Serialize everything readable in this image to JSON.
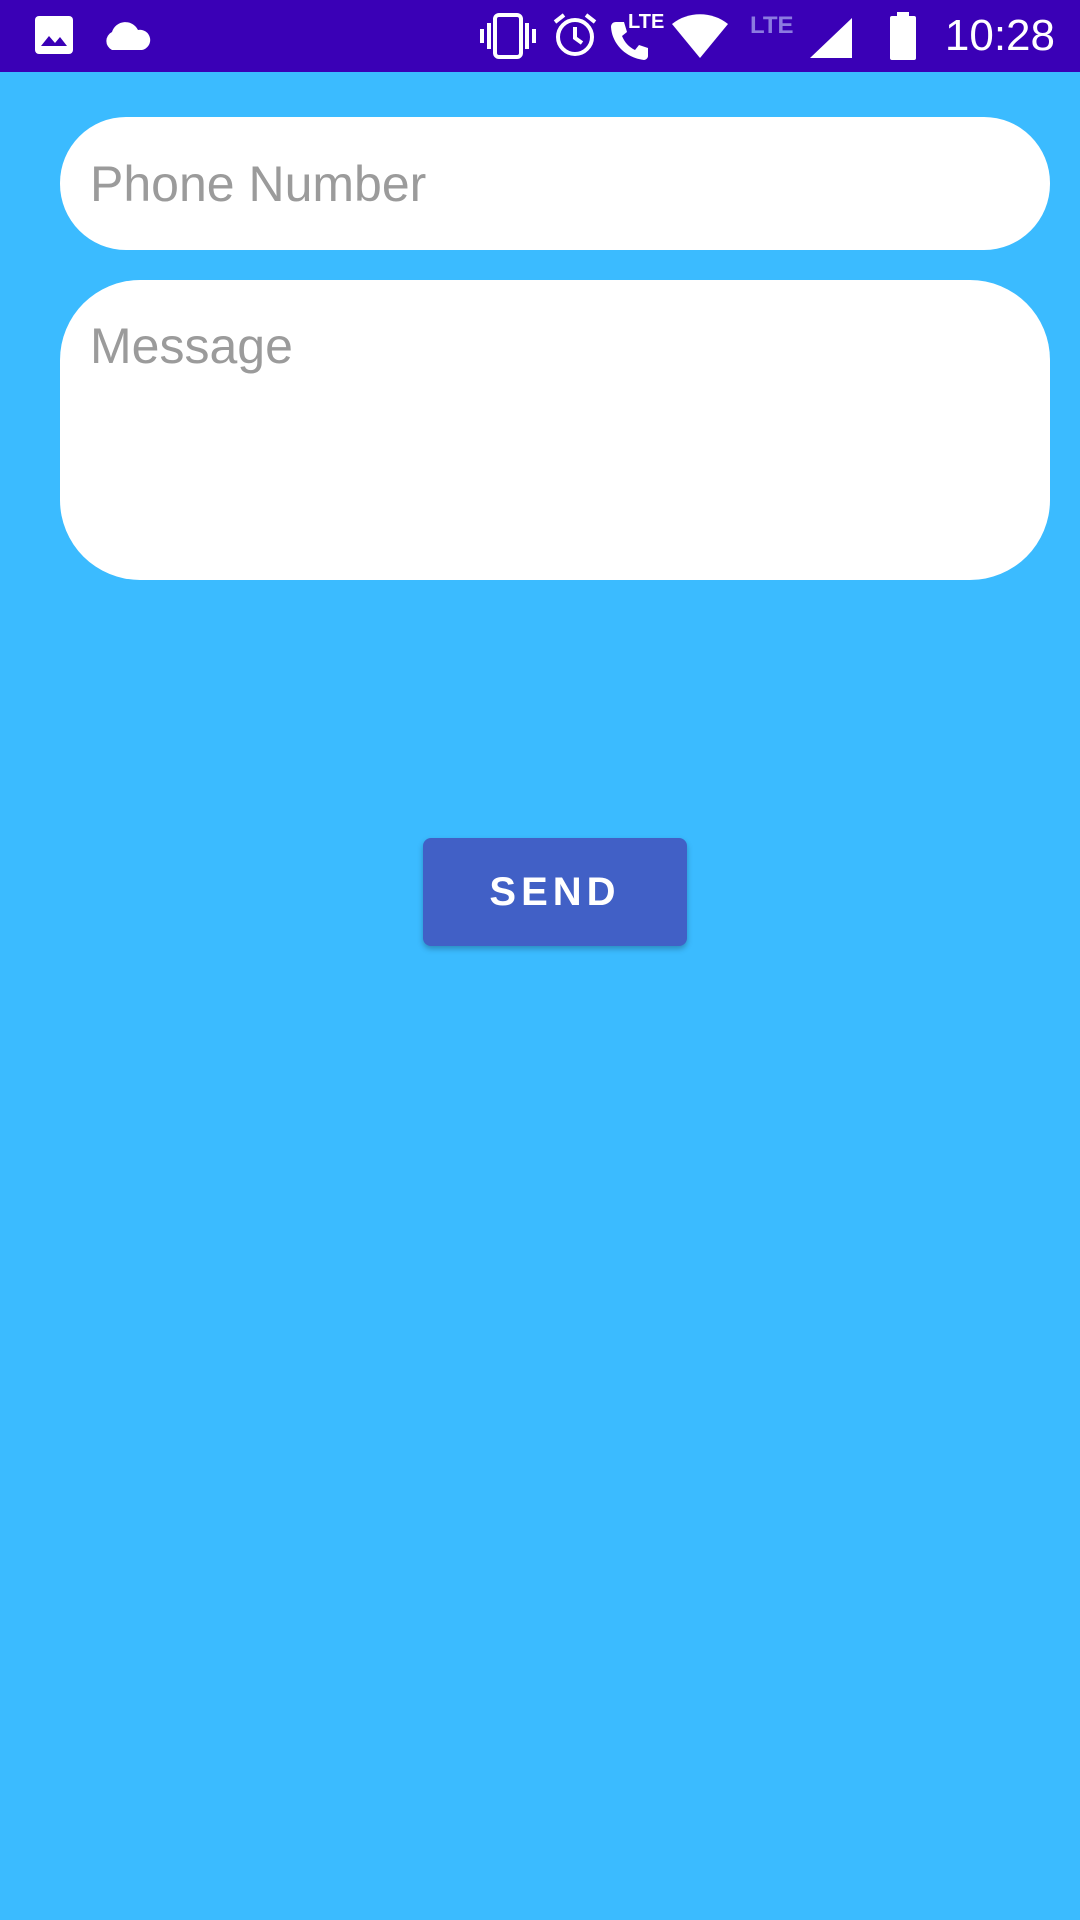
{
  "status_bar": {
    "time": "10:28",
    "lte_call_label": "LTE",
    "lte_signal_label": "LTE",
    "icons": [
      "image-icon",
      "cloud-icon",
      "vibrate-icon",
      "alarm-icon",
      "phone-lte-icon",
      "wifi-icon",
      "cell-signal-icon",
      "battery-icon"
    ],
    "background_color": "#3a00b6"
  },
  "form": {
    "phone_placeholder": "Phone Number",
    "phone_value": "",
    "message_placeholder": "Message",
    "message_value": "",
    "send_label": "SEND"
  },
  "colors": {
    "background": "#3bbbff",
    "button": "#4160c6",
    "placeholder_text": "#9b9b9b"
  }
}
